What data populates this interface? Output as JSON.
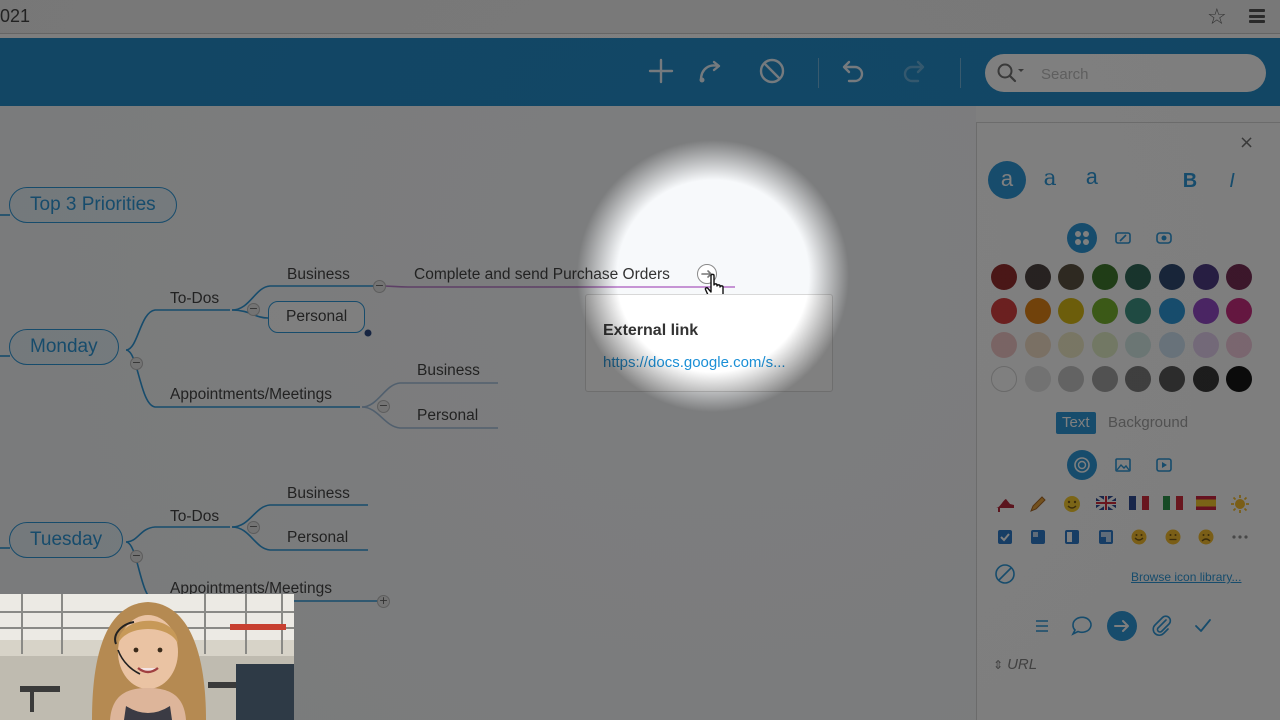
{
  "browser": {
    "url_fragment": "021"
  },
  "toolbar": {
    "icons": [
      "plus-icon",
      "redo-link-icon",
      "block-icon",
      "undo-icon",
      "redo-icon"
    ],
    "search_placeholder": "Search"
  },
  "mindmap": {
    "top_pill": "Top 3 Priorities",
    "days": [
      {
        "label": "Monday",
        "todos_label": "To-Dos",
        "todo_children": [
          "Business",
          "Personal"
        ],
        "business_child": "Complete and send Purchase Orders",
        "appointments_label": "Appointments/Meetings",
        "appointment_children": [
          "Business",
          "Personal"
        ]
      },
      {
        "label": "Tuesday",
        "todos_label": "To-Dos",
        "todo_children": [
          "Business",
          "Personal"
        ],
        "appointments_label": "Appointments/Meetings"
      }
    ]
  },
  "popover": {
    "title": "External link",
    "link": "https://docs.google.com/s..."
  },
  "panel": {
    "font_buttons": [
      "a",
      "a",
      "a"
    ],
    "style_buttons": [
      "B",
      "I"
    ],
    "color_toggle": {
      "text": "Text",
      "background": "Background"
    },
    "colors": [
      "#8b1a1a",
      "#3d3330",
      "#4d4230",
      "#2e6e1a",
      "#1c5a4a",
      "#1c3a66",
      "#3e2a7a",
      "#6b1a46",
      "#d22e2e",
      "#e07800",
      "#d6b400",
      "#6aac1a",
      "#2c8a7a",
      "#1a8fd6",
      "#8a3ac2",
      "#c41a76",
      "#f2c4c4",
      "#f4ddc4",
      "#f1ecc4",
      "#e2f0c4",
      "#d4ece8",
      "#cde3f4",
      "#e6cff2",
      "#f4c8dd",
      "#ffffff",
      "#e2e2e2",
      "#c2c2c2",
      "#9a9a9a",
      "#727272",
      "#4a4a4a",
      "#272727",
      "#000000"
    ],
    "browse_link": "Browse icon library...",
    "url_label": "URL"
  }
}
